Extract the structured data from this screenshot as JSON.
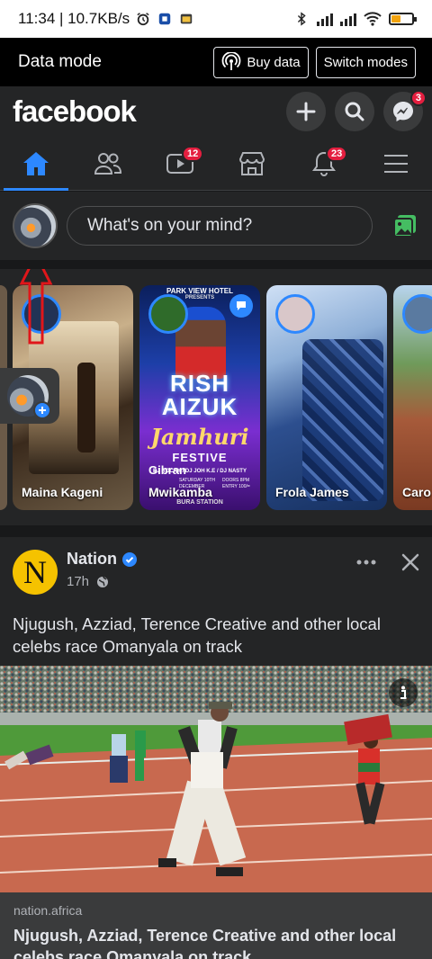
{
  "status_bar": {
    "time_speed": "11:34 | 10.7KB/s",
    "battery_level": 0.4
  },
  "data_mode_bar": {
    "title": "Data mode",
    "buy_data_label": "Buy data",
    "switch_modes_label": "Switch modes"
  },
  "header": {
    "logo": "facebook",
    "messenger_badge": "3"
  },
  "tabs": {
    "watch_badge": "12",
    "notifications_badge": "23"
  },
  "composer": {
    "placeholder": "What's on your mind?"
  },
  "stories": [
    {
      "name": "Maina Kageni"
    },
    {
      "name": "Mwikamba",
      "poster_header": "PARK VIEW HOTEL",
      "poster_presents": "PRESENTS",
      "poster_big": "RISH AIZUK",
      "poster_script": "Jamhuri",
      "poster_festive": "FESTIVE",
      "poster_overlay_name": "Gibran",
      "poster_djs": "DJ ROCKY / DJ JOH K.E / DJ NASTY",
      "poster_date": "SATURDAY 10TH DECEMBER",
      "poster_doors": "DOORS 8PM",
      "poster_entry": "ENTRY 100/=",
      "poster_station": "BURA STATION"
    },
    {
      "name": "Frola James"
    },
    {
      "name": "Caro"
    }
  ],
  "post": {
    "author": "Nation",
    "author_initial": "N",
    "time": "17h",
    "text": "Njugush, Azziad, Terence Creative and other local celebs race Omanyala on track",
    "link_domain": "nation.africa",
    "link_title": "Njugush, Azziad, Terence Creative and other local celebs race Omanyala on track"
  },
  "colors": {
    "accent": "#2d88ff",
    "badge": "#e41e3f",
    "background": "#18191a",
    "surface": "#242526",
    "nation_yellow": "#f5c200"
  }
}
